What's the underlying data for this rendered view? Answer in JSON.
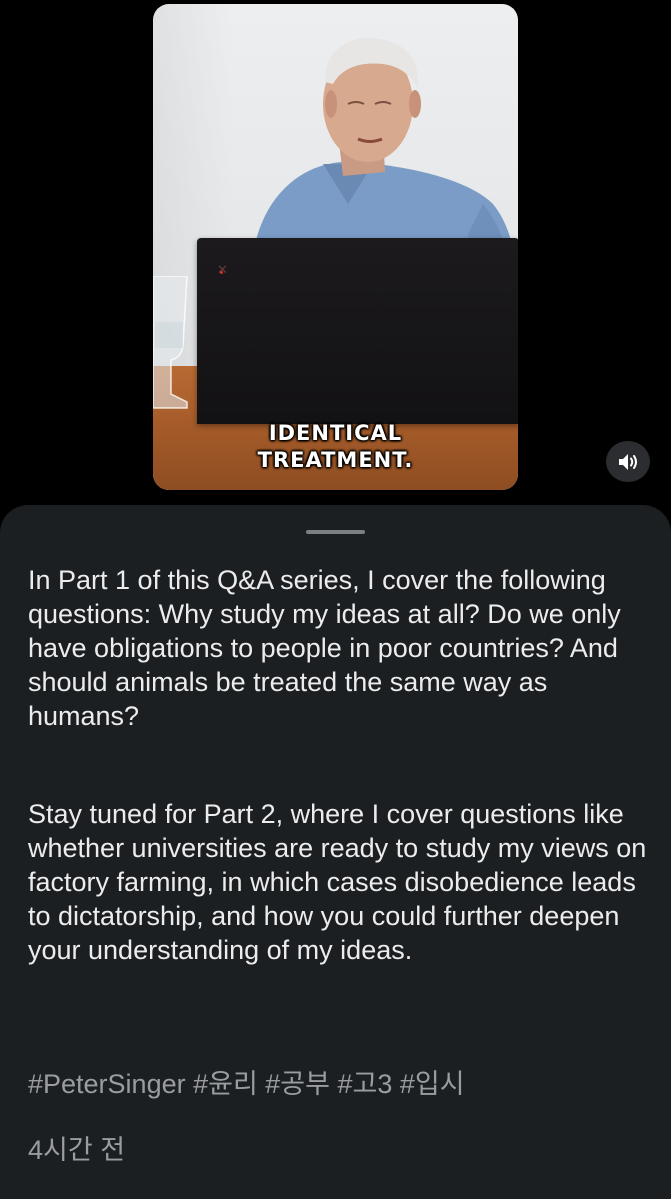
{
  "video": {
    "caption_line1": "IDENTICAL",
    "caption_line2": "TREATMENT.",
    "volume_icon": "speaker-volume-icon"
  },
  "description": {
    "paragraph1": "In Part 1 of this Q&A series, I cover the following questions: Why study my ideas at all? Do we only have obligations to people in poor countries? And should animals be treated the same way as humans?",
    "paragraph2": "Stay tuned for Part 2, where I cover questions like whether universities are ready to study my views on factory farming, in which cases disobedience leads to dictatorship, and how you could further deepen your understanding of my ideas.",
    "hashtags": "#PeterSinger #윤리 #공부 #고3 #입시",
    "timestamp": "4시간 전"
  },
  "colors": {
    "background": "#000000",
    "sheet": "#1b1f22",
    "body_text": "#ececec",
    "muted_text": "#9a9c9f"
  }
}
